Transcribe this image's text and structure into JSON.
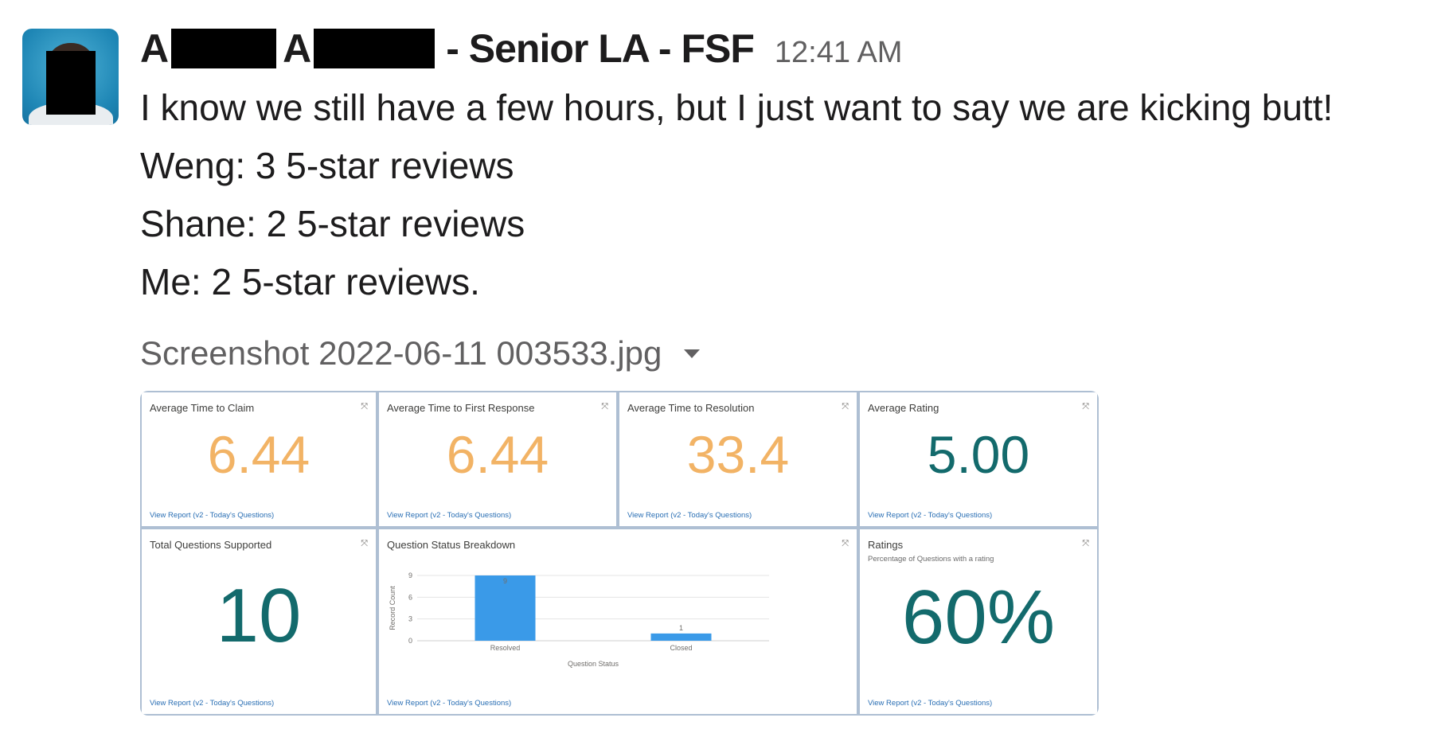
{
  "message": {
    "sender_initial_1": "A",
    "sender_initial_2": "A",
    "sender_suffix": "- Senior LA - FSF",
    "timestamp": "12:41 AM",
    "lines": [
      "I know we still have a few hours, but I just want to say we are kicking butt!",
      "Weng: 3 5-star reviews",
      "Shane: 2 5-star reviews",
      "Me: 2 5-star reviews."
    ]
  },
  "attachment": {
    "filename": "Screenshot 2022-06-11 003533.jpg",
    "caret_icon": "caret-down-icon"
  },
  "dashboard": {
    "expand_icon": "⤧",
    "view_report": "View Report (v2 - Today's Questions)",
    "cards": [
      {
        "title": "Average Time to Claim",
        "value": "6.44"
      },
      {
        "title": "Average Time to First Response",
        "value": "6.44"
      },
      {
        "title": "Average Time to Resolution",
        "value": "33.4"
      },
      {
        "title": "Average Rating",
        "value": "5.00"
      }
    ],
    "total": {
      "title": "Total Questions Supported",
      "value": "10"
    },
    "breakdown": {
      "title": "Question Status Breakdown"
    },
    "ratings": {
      "title": "Ratings",
      "subtitle": "Percentage of Questions with a rating",
      "value": "60%"
    },
    "colors": {
      "orange": "#f2b365",
      "teal": "#136a6c",
      "bar": "#3a9ae8",
      "link": "#2a6fb4"
    }
  },
  "chart_data": {
    "type": "bar",
    "title": "Question Status Breakdown",
    "categories": [
      "Resolved",
      "Closed"
    ],
    "values": [
      9,
      1
    ],
    "xlabel": "Question Status",
    "ylabel": "Record Count",
    "ylim": [
      0,
      9
    ],
    "yticks": [
      "0",
      "3",
      "6",
      "9"
    ],
    "data_labels": [
      "9",
      "1"
    ],
    "grid": true
  }
}
